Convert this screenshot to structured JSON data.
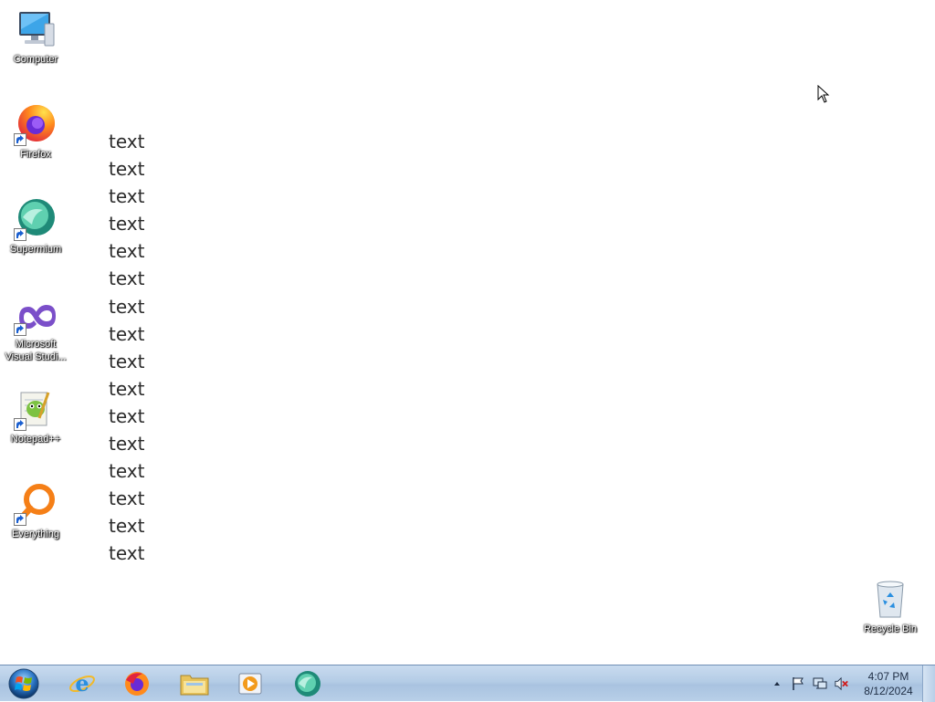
{
  "desktop": {
    "icons": [
      {
        "label": "Computer"
      },
      {
        "label": "Firefox"
      },
      {
        "label": "Supermium"
      },
      {
        "label": "Microsoft Visual Studi..."
      },
      {
        "label": "Notepad++"
      },
      {
        "label": "Everything"
      }
    ],
    "recycle_bin": {
      "label": "Recycle Bin"
    },
    "text_rows": [
      "text",
      "text",
      "text",
      "text",
      "text",
      "text",
      "text",
      "text",
      "text",
      "text",
      "text",
      "text",
      "text",
      "text",
      "text",
      "text"
    ]
  },
  "taskbar": {
    "pinned": [
      "internet-explorer-icon",
      "firefox-icon",
      "file-explorer-icon",
      "media-player-icon",
      "supermium-icon"
    ],
    "clock": {
      "time": "4:07 PM",
      "date": "8/12/2024"
    }
  },
  "colors": {
    "taskbar_top": "#c9dbef",
    "taskbar_bottom": "#b8cfe8",
    "desktop_bg": "#ffffff"
  }
}
